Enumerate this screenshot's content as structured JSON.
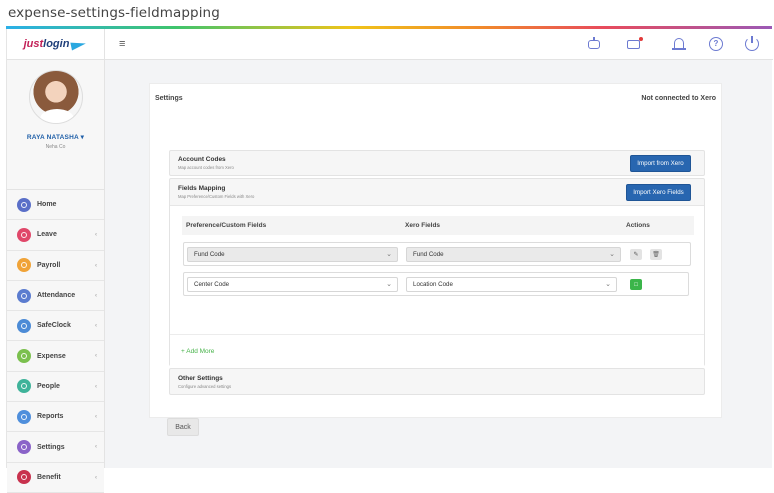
{
  "page_label": "expense-settings-fieldmapping",
  "brand": {
    "logo_part1": "just",
    "logo_part2": "login"
  },
  "profile": {
    "name": "RAYA NATASHA ▾",
    "company": "Neha Co"
  },
  "nav": [
    {
      "label": "Home",
      "color": "#5a6fc8",
      "chevron": false
    },
    {
      "label": "Leave",
      "color": "#e0486a",
      "chevron": true
    },
    {
      "label": "Payroll",
      "color": "#f0a338",
      "chevron": true
    },
    {
      "label": "Attendance",
      "color": "#5b7ccf",
      "chevron": true
    },
    {
      "label": "SafeClock",
      "color": "#4c8bd6",
      "chevron": true
    },
    {
      "label": "Expense",
      "color": "#7bc04e",
      "chevron": true
    },
    {
      "label": "People",
      "color": "#3fb39a",
      "chevron": true
    },
    {
      "label": "Reports",
      "color": "#4f8fdc",
      "chevron": true
    },
    {
      "label": "Settings",
      "color": "#8a63c8",
      "chevron": true
    },
    {
      "label": "Benefit",
      "color": "#c8324e",
      "chevron": true
    }
  ],
  "topbar": {
    "menu_icon": "≡"
  },
  "main": {
    "title": "Settings",
    "status": "Not connected to Xero",
    "account_codes": {
      "title": "Account Codes",
      "subtitle": "Map account codes from Xero",
      "button": "Import from Xero"
    },
    "fields_mapping": {
      "title": "Fields Mapping",
      "subtitle": "Map Preference/Custom Fields with Xero",
      "button": "Import Xero Fields",
      "headers": {
        "preference": "Preference/Custom Fields",
        "xero": "Xero Fields",
        "actions": "Actions"
      },
      "rows": [
        {
          "preference": "Fund Code",
          "xero": "Fund Code",
          "state": "saved"
        },
        {
          "preference": "Center Code",
          "xero": "Location Code",
          "state": "editing"
        }
      ],
      "add_more": "+ Add More"
    },
    "other_settings": {
      "title": "Other Settings",
      "subtitle": "Configure advanced settings"
    },
    "back_button": "Back"
  }
}
